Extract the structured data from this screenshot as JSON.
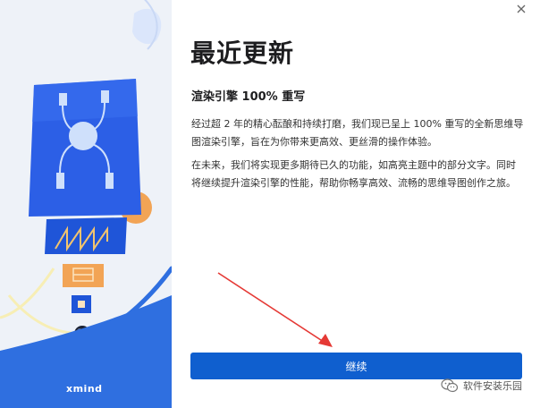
{
  "dialog": {
    "title": "最近更新",
    "subtitle": "渲染引擎 100% 重写",
    "paragraphs": [
      "经过超 2 年的精心酝酿和持续打磨，我们现已呈上 100% 重写的全新思维导图渲染引擎，旨在为你带来更高效、更丝滑的操作体验。",
      "在未来，我们将实现更多期待已久的功能，如高亮主题中的部分文字。同时将继续提升渲染引擎的性能，帮助你畅享高效、流畅的思维导图创作之旅。"
    ],
    "continue_label": "继续",
    "brand": "xmind"
  },
  "watermark": {
    "text": "软件安装乐园",
    "icon": "wechat-icon"
  },
  "icons": {
    "close": "close-icon"
  },
  "colors": {
    "accent": "#0f5fcf",
    "art_background": "#eef2f8",
    "annotation_arrow": "#e53935"
  }
}
